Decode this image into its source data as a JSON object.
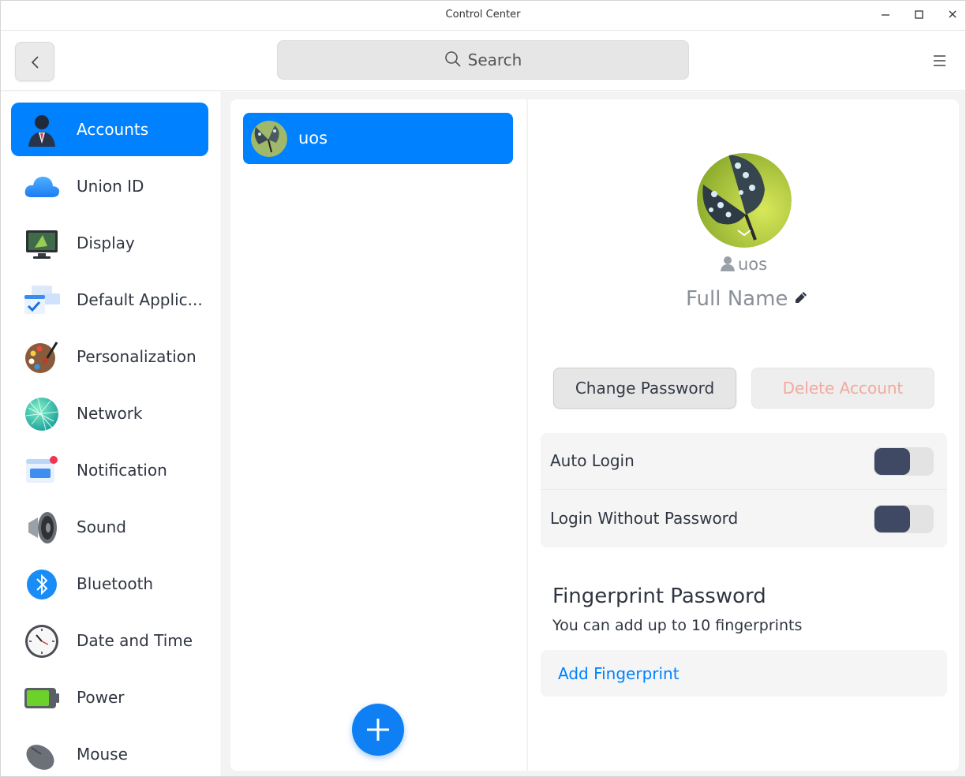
{
  "window": {
    "title": "Control Center"
  },
  "toolbar": {
    "search_placeholder": "Search"
  },
  "sidebar": {
    "items": [
      {
        "label": "Accounts",
        "icon": "accounts-icon",
        "active": true
      },
      {
        "label": "Union ID",
        "icon": "cloud-icon"
      },
      {
        "label": "Display",
        "icon": "display-icon"
      },
      {
        "label": "Default Applic...",
        "icon": "default-apps-icon"
      },
      {
        "label": "Personalization",
        "icon": "palette-icon"
      },
      {
        "label": "Network",
        "icon": "network-icon"
      },
      {
        "label": "Notification",
        "icon": "notification-icon"
      },
      {
        "label": "Sound",
        "icon": "speaker-icon"
      },
      {
        "label": "Bluetooth",
        "icon": "bluetooth-icon"
      },
      {
        "label": "Date and Time",
        "icon": "clock-icon"
      },
      {
        "label": "Power",
        "icon": "battery-icon"
      },
      {
        "label": "Mouse",
        "icon": "mouse-icon"
      }
    ]
  },
  "accounts": {
    "list": [
      {
        "name": "uos"
      }
    ]
  },
  "detail": {
    "username": "uos",
    "full_name": "Full Name",
    "change_password": "Change Password",
    "delete_account": "Delete Account",
    "auto_login": "Auto Login",
    "login_without_password": "Login Without Password",
    "fingerprint_title": "Fingerprint Password",
    "fingerprint_sub": "You can add up to 10 fingerprints",
    "add_fingerprint": "Add Fingerprint"
  },
  "colors": {
    "accent": "#0081ff",
    "toggle_knob": "#404963",
    "delete_text": "#f2a99e"
  }
}
